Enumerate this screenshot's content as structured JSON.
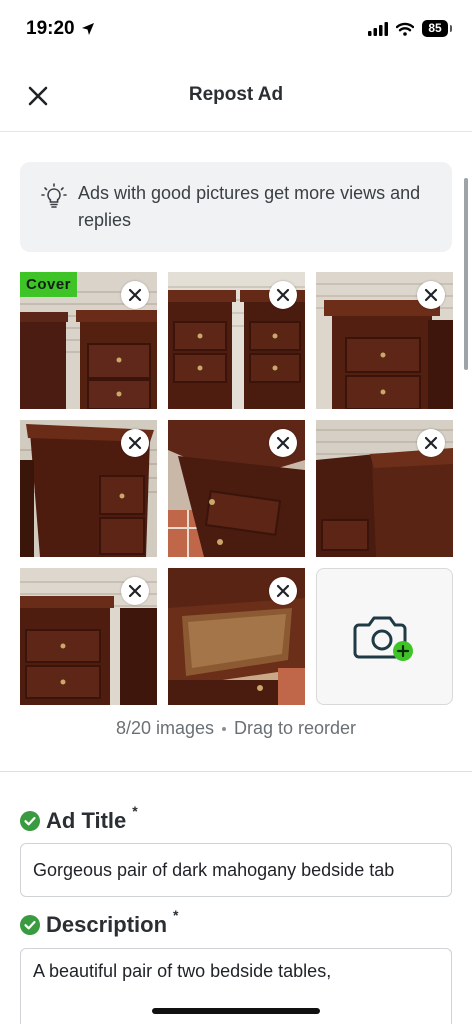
{
  "status_bar": {
    "time": "19:20",
    "battery": "85"
  },
  "header": {
    "title": "Repost Ad"
  },
  "tip": {
    "text": "Ads with good pictures get more views and replies"
  },
  "photos": {
    "cover_label": "Cover",
    "count_text": "8/20 images",
    "drag_text": "Drag to reorder"
  },
  "form": {
    "title_label": "Ad Title",
    "title_required": "*",
    "title_value": "Gorgeous pair of dark mahogany bedside tab",
    "description_label": "Description",
    "description_required": "*",
    "description_value": "A beautiful pair of two bedside tables,"
  },
  "colors": {
    "accent_green": "#3ec427",
    "check_green": "#3a9a3f",
    "camera_teal": "#1f3a44"
  },
  "icons": [
    "navigation-arrow-icon",
    "signal-icon",
    "wifi-icon",
    "close-icon",
    "lightbulb-icon",
    "remove-photo-icon",
    "camera-add-icon",
    "check-circle-icon"
  ]
}
